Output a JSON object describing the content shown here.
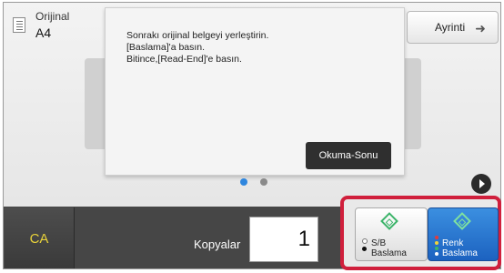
{
  "original": {
    "label": "Orijinal",
    "size": "A4"
  },
  "detail_button": {
    "label": "Ayrinti"
  },
  "dialog": {
    "message_lines": [
      "Sonrakı orijinal belgeyi yerleştirin.",
      "[Baslama]'a basın.",
      "Bitince,[Read-End]'e basın."
    ],
    "read_end_button": "Okuma-Sonu"
  },
  "pager": {
    "pages": 2,
    "active": 1
  },
  "bottom_bar": {
    "ca_label": "CA",
    "copies_label": "Kopyalar",
    "copies_value": "1"
  },
  "start_buttons": {
    "bw": {
      "line1": "S/B",
      "line2": "Baslama"
    },
    "color": {
      "line1": "Renk",
      "line2": "Baslama"
    }
  },
  "colors": {
    "accent_blue": "#1c62c0",
    "highlight_red": "#d01f3c",
    "ca_yellow": "#e8d23a",
    "start_green": "#3cb46a"
  }
}
